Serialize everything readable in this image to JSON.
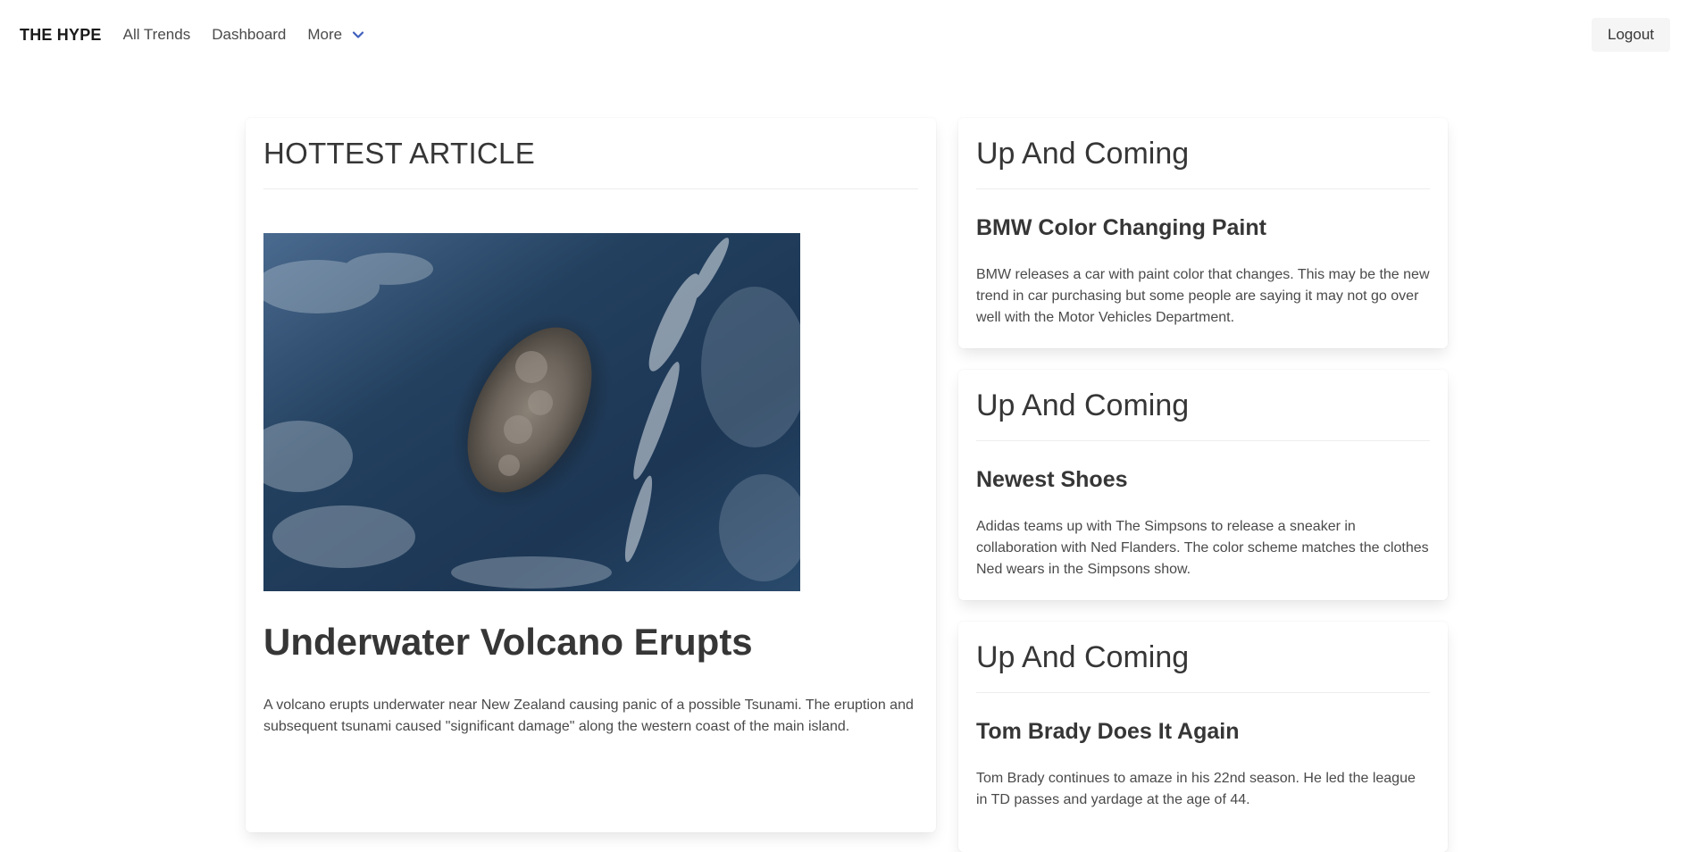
{
  "nav": {
    "brand": "THE HYPE",
    "links": [
      "All Trends",
      "Dashboard"
    ],
    "more_label": "More",
    "logout_label": "Logout"
  },
  "hottest": {
    "heading": "HOTTEST ARTICLE",
    "title": "Underwater Volcano Erupts",
    "body": "A volcano erupts underwater near New Zealand causing panic of a possible Tsunami. The eruption and subsequent tsunami caused \"significant damage\" along the western coast of the main island."
  },
  "up_and_coming": [
    {
      "heading": "Up And Coming",
      "title": "BMW Color Changing Paint",
      "body": "BMW releases a car with paint color that changes. This may be the new trend in car purchasing but some people are saying it may not go over well with the Motor Vehicles Department."
    },
    {
      "heading": "Up And Coming",
      "title": "Newest Shoes",
      "body": "Adidas teams up with The Simpsons to release a sneaker in collaboration with Ned Flanders. The color scheme matches the clothes Ned wears in the Simpsons show."
    },
    {
      "heading": "Up And Coming",
      "title": "Tom Brady Does It Again",
      "body": "Tom Brady continues to amaze in his 22nd season. He led the league in TD passes and yardage at the age of 44."
    }
  ],
  "colors": {
    "accent": "#3e5fbd",
    "text": "#4a4a4a",
    "heading": "#363636"
  },
  "icons": {
    "more": "chevron-down-icon"
  }
}
